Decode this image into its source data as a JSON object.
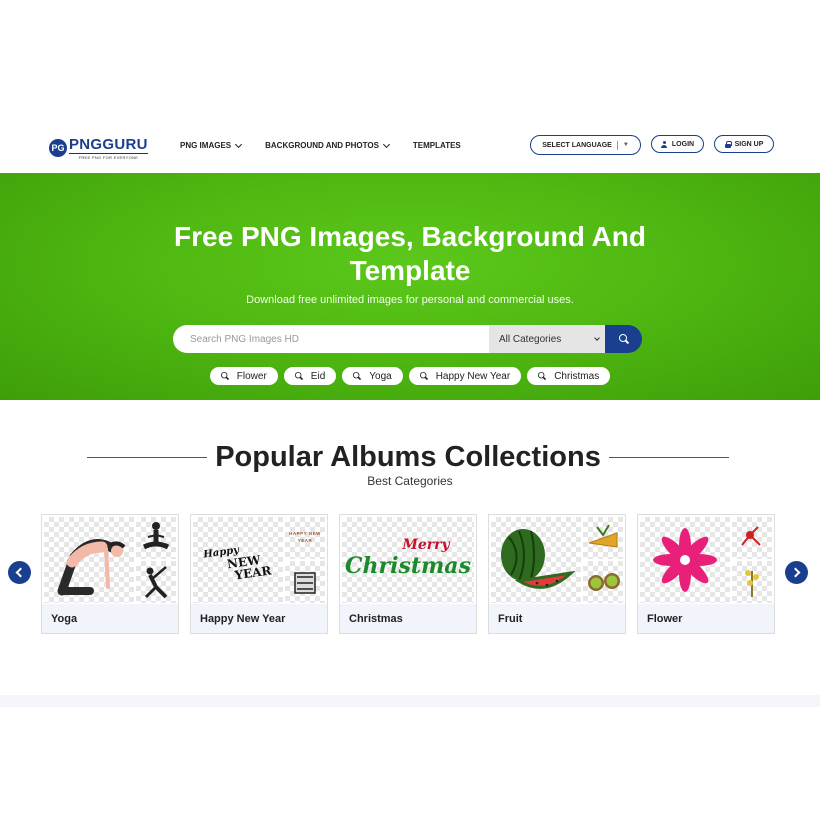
{
  "brand": {
    "badge": "PG",
    "name": "PNGGURU",
    "tagline": "FREE PNG FOR EVERYONE"
  },
  "nav": {
    "items": [
      {
        "label": "PNG IMAGES",
        "has_caret": true
      },
      {
        "label": "BACKGROUND AND PHOTOS",
        "has_caret": true
      },
      {
        "label": "TEMPLATES",
        "has_caret": false
      }
    ],
    "language_label": "SELECT LANGUAGE",
    "language_arrow": "▼",
    "login_label": "LOGIN",
    "signup_label": "SIGN UP"
  },
  "hero": {
    "title_line1": "Free PNG Images, Background And",
    "title_line2": "Template",
    "subtitle": "Download free unlimited images for personal and commercial uses.",
    "search_placeholder": "Search PNG Images HD",
    "category_selected": "All Categories",
    "tags": [
      "Flower",
      "Eid",
      "Yoga",
      "Happy New Year",
      "Christmas"
    ]
  },
  "albums": {
    "title": "Popular Albums Collections",
    "subtitle": "Best Categories",
    "cards": [
      {
        "label": "Yoga"
      },
      {
        "label": "Happy New Year",
        "art_line1": "Happy",
        "art_line2": "NEW",
        "art_line3": "YEAR",
        "side_text": "HAPPY NEW YEAR"
      },
      {
        "label": "Christmas",
        "art_line1": "Merry",
        "art_line2": "Christmas"
      },
      {
        "label": "Fruit"
      },
      {
        "label": "Flower"
      }
    ]
  },
  "colors": {
    "brand_blue": "#1a3f8f",
    "hero_green": "#4fb812",
    "card_label_bg": "#f2f4fb"
  }
}
